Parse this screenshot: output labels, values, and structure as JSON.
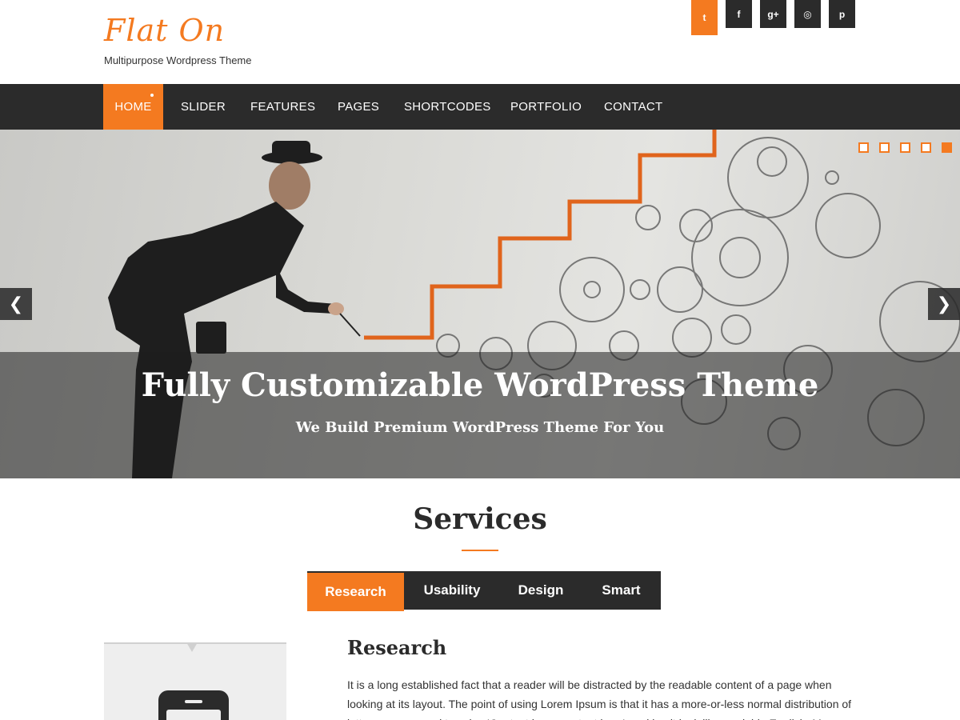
{
  "header": {
    "logo_text": "Flat On",
    "tagline": "Multipurpose Wordpress Theme",
    "social": [
      {
        "icon": "twitter-icon",
        "glyph": "t"
      },
      {
        "icon": "facebook-icon",
        "glyph": "f"
      },
      {
        "icon": "google-plus-icon",
        "glyph": "g+"
      },
      {
        "icon": "dribbble-icon",
        "glyph": "◎"
      },
      {
        "icon": "pinterest-icon",
        "glyph": "p"
      }
    ]
  },
  "nav": {
    "items": [
      {
        "label": "HOME",
        "active": true
      },
      {
        "label": "SLIDER"
      },
      {
        "label": "FEATURES"
      },
      {
        "label": "PAGES"
      },
      {
        "label": "SHORTCODES"
      },
      {
        "label": "PORTFOLIO"
      },
      {
        "label": "CONTACT"
      }
    ]
  },
  "slider": {
    "title": "Fully Customizable WordPress Theme",
    "subtitle": "We Build Premium WordPress Theme For You",
    "prev_glyph": "❮",
    "next_glyph": "❯",
    "slide_count": 5,
    "active_slide": 5
  },
  "services": {
    "title": "Services",
    "tabs": [
      {
        "label": "Research",
        "active": true
      },
      {
        "label": "Usability"
      },
      {
        "label": "Design"
      },
      {
        "label": "Smart"
      }
    ],
    "panel_heading": "Research",
    "panel_text": "It is a long established fact that a reader will be distracted by the readable content of a page when looking at its layout. The point of using Lorem Ipsum is that it has a more-or-less normal distribution of letters, as opposed to using 'Content here, content here', making it look like readable English. Many desktop publishing packages and"
  },
  "colors": {
    "accent": "#f47a20",
    "dark": "#2b2b2b"
  }
}
